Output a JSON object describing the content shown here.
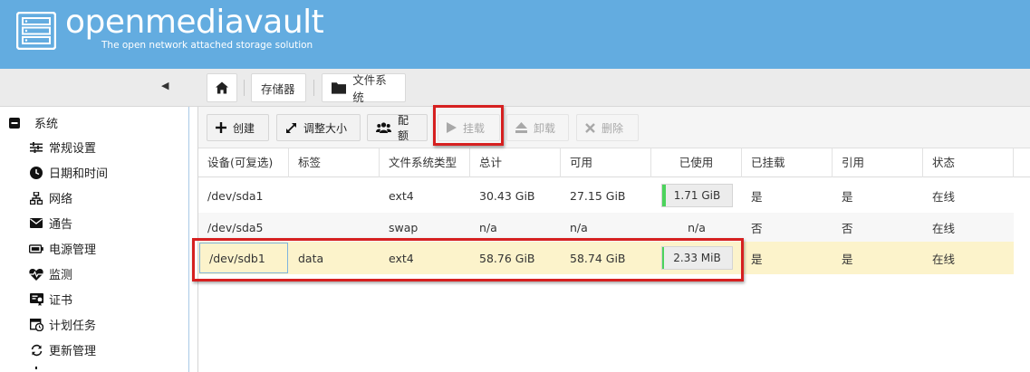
{
  "brand": {
    "name": "openmediavault",
    "tagline": "The open network attached storage solution"
  },
  "breadcrumb": {
    "home_icon": "home-icon",
    "items": [
      "存储器",
      "文件系统"
    ]
  },
  "sidebar": {
    "section": "系统",
    "items": [
      {
        "label": "常规设置",
        "icon": "sliders-icon"
      },
      {
        "label": "日期和时间",
        "icon": "clock-icon"
      },
      {
        "label": "网络",
        "icon": "network-icon"
      },
      {
        "label": "通告",
        "icon": "envelope-icon"
      },
      {
        "label": "电源管理",
        "icon": "battery-icon"
      },
      {
        "label": "监测",
        "icon": "heartbeat-icon"
      },
      {
        "label": "证书",
        "icon": "certificate-icon"
      },
      {
        "label": "计划任务",
        "icon": "calendar-clock-icon"
      },
      {
        "label": "更新管理",
        "icon": "refresh-icon"
      }
    ]
  },
  "toolbar": {
    "create": "创建",
    "resize": "调整大小",
    "quota": "配额",
    "mount": "挂载",
    "unmount": "卸载",
    "delete": "删除"
  },
  "grid": {
    "columns": [
      "设备(可复选)",
      "标签",
      "文件系统类型",
      "总计",
      "可用",
      "已使用",
      "已挂载",
      "引用",
      "状态"
    ],
    "rows": [
      {
        "device": "/dev/sda1",
        "label": "",
        "type": "ext4",
        "total": "30.43 GiB",
        "available": "27.15 GiB",
        "used": "1.71 GiB",
        "used_fraction": 0.056,
        "mounted": "是",
        "referenced": "是",
        "status": "在线"
      },
      {
        "device": "/dev/sda5",
        "label": "",
        "type": "swap",
        "total": "n/a",
        "available": "n/a",
        "used": "n/a",
        "used_fraction": 0,
        "mounted": "否",
        "referenced": "否",
        "status": "在线"
      },
      {
        "device": "/dev/sdb1",
        "label": "data",
        "type": "ext4",
        "total": "58.76 GiB",
        "available": "58.74 GiB",
        "used": "2.33 MiB",
        "used_fraction": 0.0001,
        "mounted": "是",
        "referenced": "是",
        "status": "在线"
      }
    ]
  },
  "colors": {
    "header": "#63ace0",
    "selected_row": "#fcf3cb",
    "usage_fill": "#4cd35c",
    "highlight": "#d62020"
  }
}
